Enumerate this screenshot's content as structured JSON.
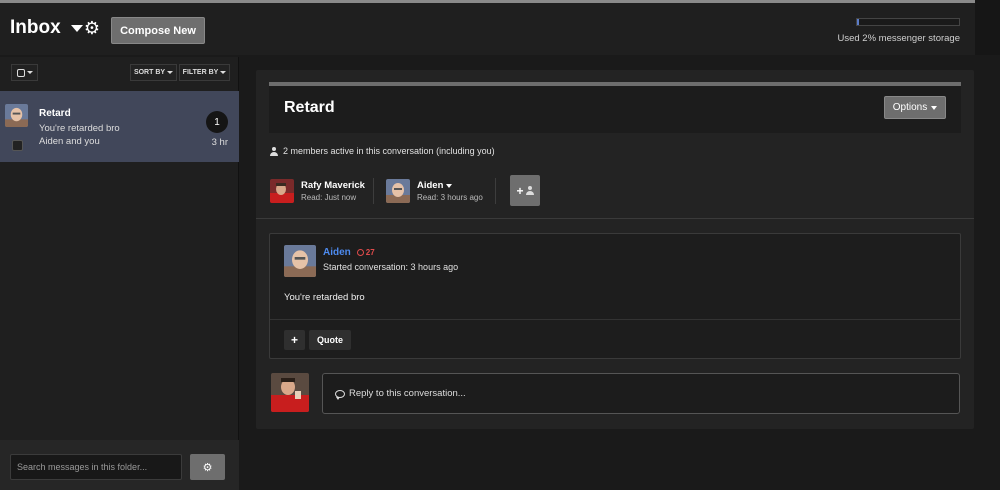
{
  "header": {
    "title": "Inbox",
    "compose_label": "Compose New",
    "storage_text": "Used 2% messenger storage",
    "storage_percent": 2
  },
  "sidebar": {
    "sort_label": "SORT BY",
    "filter_label": "FILTER BY",
    "conversation": {
      "title": "Retard",
      "snippet": "You're retarded bro",
      "members": "Aiden and you",
      "unread_count": "1",
      "time": "3 hr"
    },
    "search_placeholder": "Search messages in this folder..."
  },
  "conversation": {
    "title": "Retard",
    "options_label": "Options",
    "active_text": "2 members active in this conversation (including you)",
    "members": [
      {
        "name": "Rafy Maverick",
        "read": "Read: Just now"
      },
      {
        "name": "Aiden",
        "read": "Read: 3 hours ago"
      }
    ],
    "message": {
      "author": "Aiden",
      "reputation": "27",
      "started": "Started conversation: 3 hours ago",
      "body": "You're retarded bro",
      "plus_label": "+",
      "quote_label": "Quote"
    },
    "reply_placeholder": "Reply to this conversation..."
  },
  "colors": {
    "accent_blue": "#4d8bf0",
    "rep_red": "#e04b4b",
    "selected_row": "#41475a",
    "button_gray": "#6e6e6e"
  }
}
